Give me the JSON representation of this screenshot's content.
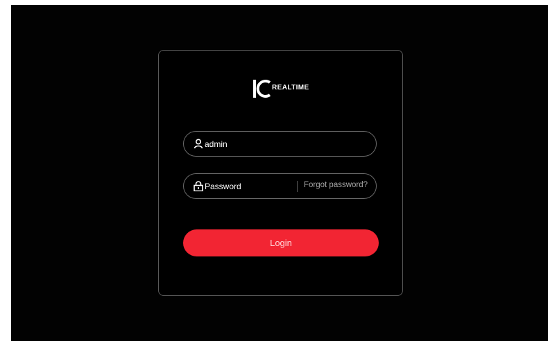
{
  "brand": {
    "logo_text": "REALTIME",
    "logo_mark": "IC"
  },
  "login": {
    "username_value": "admin",
    "password_placeholder": "Password",
    "forgot_label": "Forgot password?",
    "login_label": "Login"
  },
  "colors": {
    "background": "#020202",
    "card_border": "#5a5a5a",
    "accent": "#f22533"
  },
  "icons": {
    "user": "user-icon",
    "lock": "lock-icon"
  }
}
